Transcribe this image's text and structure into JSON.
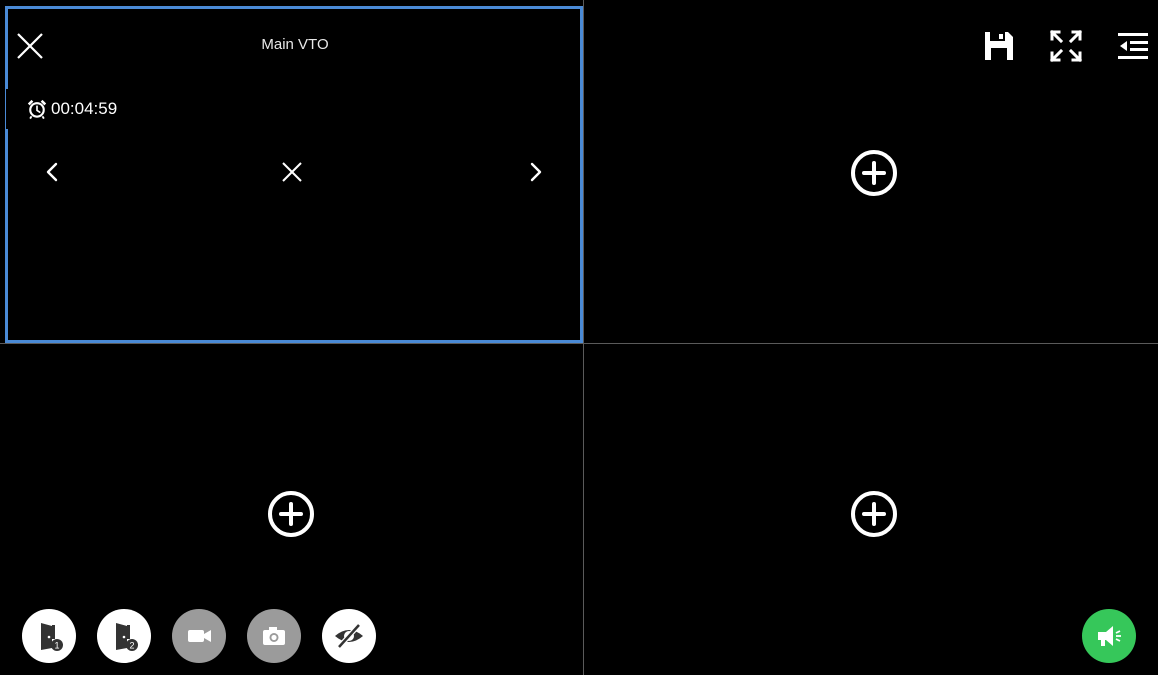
{
  "window": {
    "channel_title": "Main VTO",
    "timer": "00:04:59"
  },
  "colors": {
    "selected_border": "#4a8ad6",
    "speak_button": "#36c75a",
    "active_button": "#ffffff",
    "disabled_button": "#9b9b9b"
  },
  "icons": {
    "close": "close-icon",
    "alarm": "alarm-clock-icon",
    "prev": "chevron-left-icon",
    "next": "chevron-right-icon",
    "no_video": "x-icon",
    "add": "plus-circle-icon",
    "save": "save-icon",
    "fullscreen": "fullscreen-icon",
    "menu": "menu-collapse-icon",
    "unlock_1": "door-unlock-1-icon",
    "unlock_2": "door-unlock-2-icon",
    "record": "video-camera-icon",
    "snapshot": "camera-icon",
    "privacy": "eye-off-icon",
    "speak": "megaphone-icon"
  }
}
